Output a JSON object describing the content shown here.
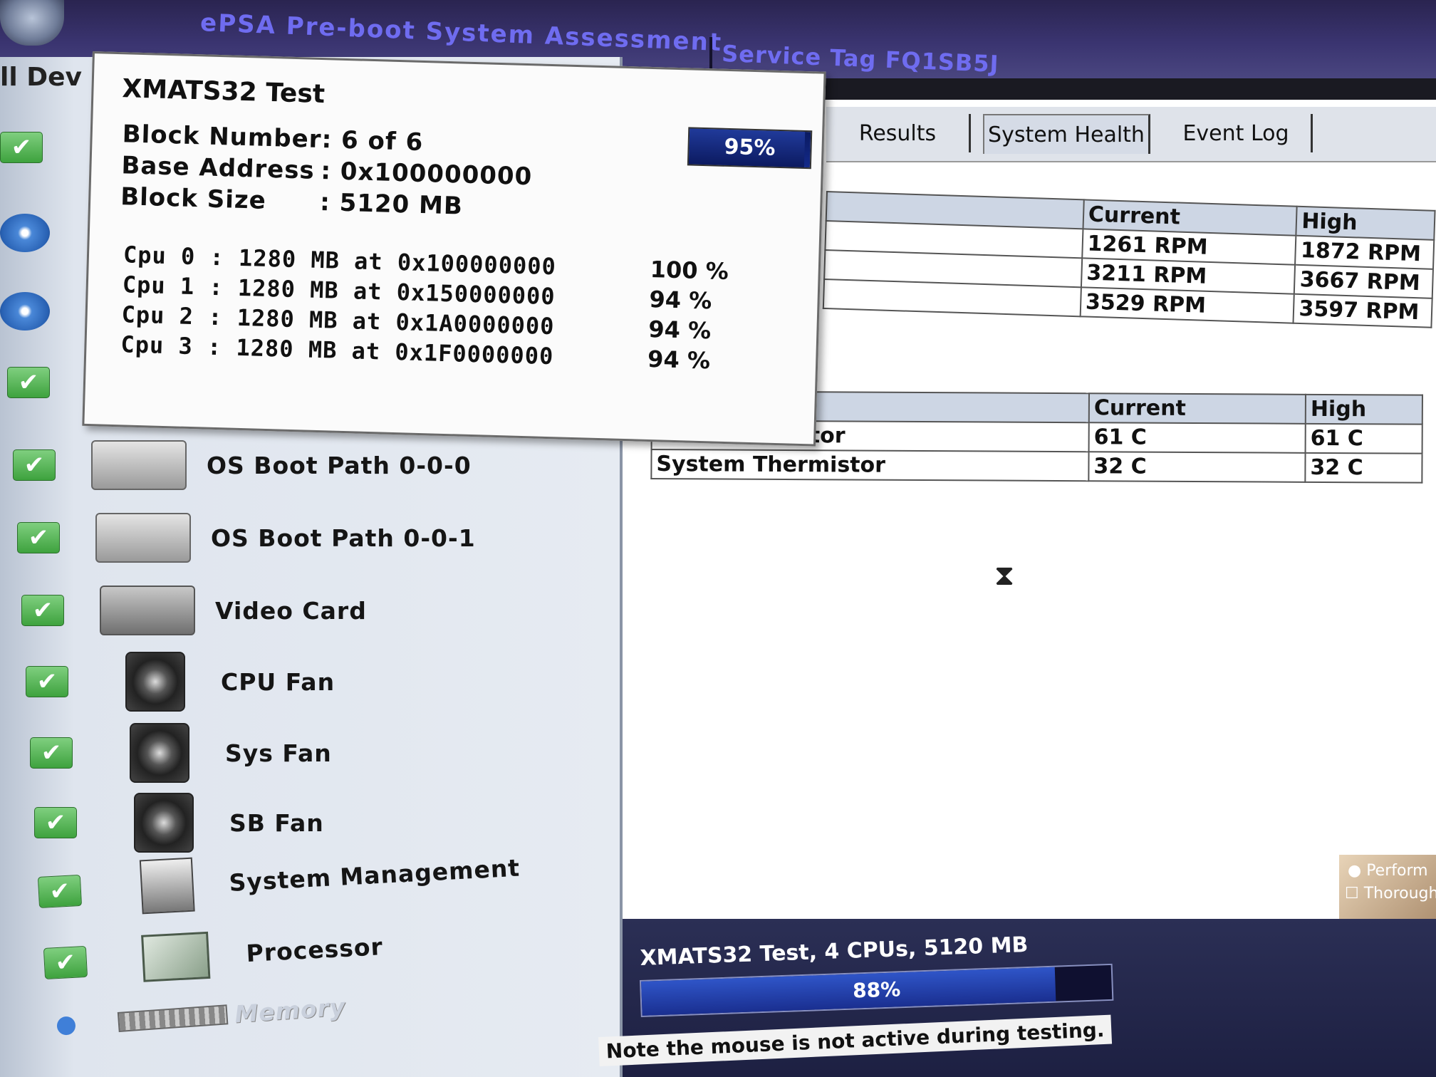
{
  "titlebar": {
    "app_title": "ePSA Pre-boot System Assessment",
    "service_tag": "Service Tag FQ1SB5J"
  },
  "left_panel": {
    "header": "ll Dev",
    "devices": [
      {
        "label": "OS Boot Path 0-0-0",
        "status": "pass"
      },
      {
        "label": "OS Boot Path 0-0-1",
        "status": "pass"
      },
      {
        "label": "Video Card",
        "status": "pass"
      },
      {
        "label": "CPU Fan",
        "status": "pass"
      },
      {
        "label": "Sys Fan",
        "status": "pass"
      },
      {
        "label": "SB Fan",
        "status": "pass"
      },
      {
        "label": "System Management",
        "status": "pass"
      },
      {
        "label": "Processor",
        "status": "pass"
      },
      {
        "label": "Memory",
        "status": "in-progress"
      }
    ]
  },
  "tabs": [
    "Results",
    "System Health",
    "Event Log"
  ],
  "fan_table": {
    "headers": [
      "Current",
      "High"
    ],
    "rows": [
      [
        "1261 RPM",
        "1872 RPM"
      ],
      [
        "3211 RPM",
        "3667 RPM"
      ],
      [
        "3529 RPM",
        "3597 RPM"
      ]
    ]
  },
  "thermal_table": {
    "headers": [
      "Current",
      "High"
    ],
    "rows": [
      {
        "name": "CPU Thermistor",
        "current": "61 C",
        "high": "61 C"
      },
      {
        "name": "System Thermistor",
        "current": "32 C",
        "high": "32 C"
      }
    ]
  },
  "options": {
    "perform": "Perform",
    "thorough": "Thorough"
  },
  "progress": {
    "title": "XMATS32 Test,  4 CPUs, 5120 MB",
    "percent_text": "88%",
    "fraction": 0.88
  },
  "note": "Note the mouse is not active during testing.",
  "dialog": {
    "title": "XMATS32 Test",
    "percent_text": "95%",
    "fraction": 0.95,
    "block_number_label": "Block Number",
    "block_number_value": ": 6 of 6",
    "base_address_label": "Base Address",
    "base_address_value": ": 0x100000000",
    "block_size_label": "Block Size",
    "block_size_value": ": 5120 MB",
    "cpus": [
      {
        "text": "Cpu  0  : 1280 MB at 0x100000000",
        "pct": "100 %"
      },
      {
        "text": "Cpu  1  : 1280 MB at 0x150000000",
        "pct": "94 %"
      },
      {
        "text": "Cpu  2  : 1280 MB at 0x1A0000000",
        "pct": "94 %"
      },
      {
        "text": "Cpu  3  : 1280 MB at 0x1F0000000",
        "pct": "94 %"
      }
    ]
  },
  "colors": {
    "title_text": "#6f6cf0",
    "pass_green": "#3ea23e",
    "progress_blue": "#2f55c8"
  }
}
